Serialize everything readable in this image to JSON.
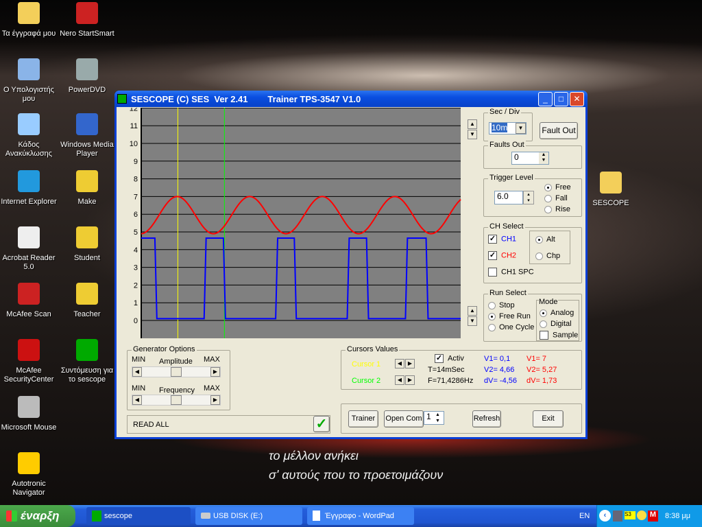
{
  "desktop": {
    "icons": [
      {
        "label": "Τα έγγραφά μου",
        "icon": "folder-icon"
      },
      {
        "label": "Nero StartSmart",
        "icon": "nero-icon"
      },
      {
        "label": "Ο Υπολογιστής μου",
        "icon": "computer-icon"
      },
      {
        "label": "PowerDVD",
        "icon": "powerdvd-icon"
      },
      {
        "label": "Κάδος Ανακύκλωσης",
        "icon": "recycle-bin-icon"
      },
      {
        "label": "Windows Media Player",
        "icon": "media-player-icon"
      },
      {
        "label": "Internet Explorer",
        "icon": "ie-icon"
      },
      {
        "label": "Make",
        "icon": "make-icon"
      },
      {
        "label": "Acrobat Reader 5.0",
        "icon": "acrobat-icon"
      },
      {
        "label": "Student",
        "icon": "student-icon"
      },
      {
        "label": "McAfee Scan",
        "icon": "mcafee-scan-icon"
      },
      {
        "label": "Teacher",
        "icon": "teacher-icon"
      },
      {
        "label": "McAfee SecurityCenter",
        "icon": "mcafee-icon"
      },
      {
        "label": "Συντόμευση για το sescope",
        "icon": "sescope-shortcut-icon"
      },
      {
        "label": "Microsoft Mouse",
        "icon": "mouse-icon"
      },
      {
        "label": "Autotronic Navigator",
        "icon": "navigator-icon"
      },
      {
        "label": "SESCOPE",
        "icon": "folder-icon"
      }
    ],
    "slogan_line1": "το μέλλον ανήκει",
    "slogan_line2": "σ' αυτούς που το προετοιμάζουν"
  },
  "window": {
    "title": "SESCOPE (C) SES  Ver 2.41        Trainer TPS-3547 V1.0",
    "sec_div": {
      "label": "Sec / Div",
      "value": "10m"
    },
    "fault_out_button": "Fault Out",
    "faults_out": {
      "label": "Faults Out",
      "value": "0"
    },
    "trigger": {
      "label": "Trigger Level",
      "value": "6.0",
      "options": [
        "Free",
        "Fall",
        "Rise"
      ],
      "selected": "Free"
    },
    "ch_select": {
      "label": "CH Select",
      "ch1": "CH1",
      "ch2": "CH2",
      "ch1_checked": true,
      "ch2_checked": true,
      "spc": "CH1  SPC",
      "spc_checked": false,
      "modes": [
        "Alt",
        "Chp"
      ],
      "selected": "Alt"
    },
    "run_select": {
      "label": "Run Select",
      "options": [
        "Stop",
        "Free Run",
        "One Cycle"
      ],
      "selected": "Free Run",
      "mode_label": "Mode",
      "modes": [
        "Analog",
        "Digital"
      ],
      "mode_selected": "Analog",
      "sample": "Sample",
      "sample_checked": false
    },
    "generator": {
      "label": "Generator Options",
      "min": "MIN",
      "max": "MAX",
      "amplitude": "Amplitude",
      "frequency": "Frequency",
      "amplitude_level": 0.5,
      "frequency_level": 0.5
    },
    "status": "READ ALL",
    "cursors": {
      "label": "Cursors Values",
      "cursor1": "Cursor 1",
      "cursor2": "Cursor 2",
      "activ": "Activ",
      "activ_checked": true,
      "t": "T=14mSec",
      "f": "F=71,4286Hz",
      "ch1": {
        "v1": "V1= 0,1",
        "v2": "V2= 4,66",
        "dv": "dV= -4,56"
      },
      "ch2": {
        "v1": "V1= 7",
        "v2": "V2= 5,27",
        "dv": "dV= 1,73"
      }
    },
    "buttons": {
      "trainer": "Trainer",
      "open_com": "Open Com",
      "com_value": "1",
      "refresh": "Refresh",
      "exit": "Exit"
    },
    "colors": {
      "ch1": "#0000ff",
      "ch2": "#ff0000",
      "cursor1": "#ffff00",
      "cursor2": "#00ff00",
      "plot_bg": "#808080"
    }
  },
  "chart_data": {
    "type": "line",
    "ylim": [
      0,
      12
    ],
    "y_ticks": [
      "0",
      "1",
      "2",
      "3",
      "4",
      "5",
      "6",
      "7",
      "8",
      "9",
      "10",
      "11",
      "12"
    ],
    "grid": true,
    "x_unit": "ms",
    "xlim": [
      0,
      96
    ],
    "cursor_positions_ms": [
      11,
      25
    ],
    "series": [
      {
        "name": "CH2",
        "color": "#ff0000",
        "waveform": "sine",
        "offset": 5.95,
        "amplitude": 1.05,
        "period_ms": 21.8,
        "peak_at_ms": 10.8
      },
      {
        "name": "CH1",
        "color": "#0000ff",
        "waveform": "pulse",
        "high": 4.65,
        "low": 0.1,
        "high_intervals_ms": [
          [
            0,
            4.1
          ],
          [
            19.5,
            24.7
          ],
          [
            41,
            46
          ],
          [
            62.5,
            67.7
          ],
          [
            80,
            85.6
          ]
        ]
      }
    ]
  },
  "taskbar": {
    "start": "έναρξη",
    "tasks": [
      "sescope",
      "USB DISK (E:)",
      "Έγγραφο - WordPad"
    ],
    "lang": "EN",
    "clock": "8:38 μμ"
  }
}
